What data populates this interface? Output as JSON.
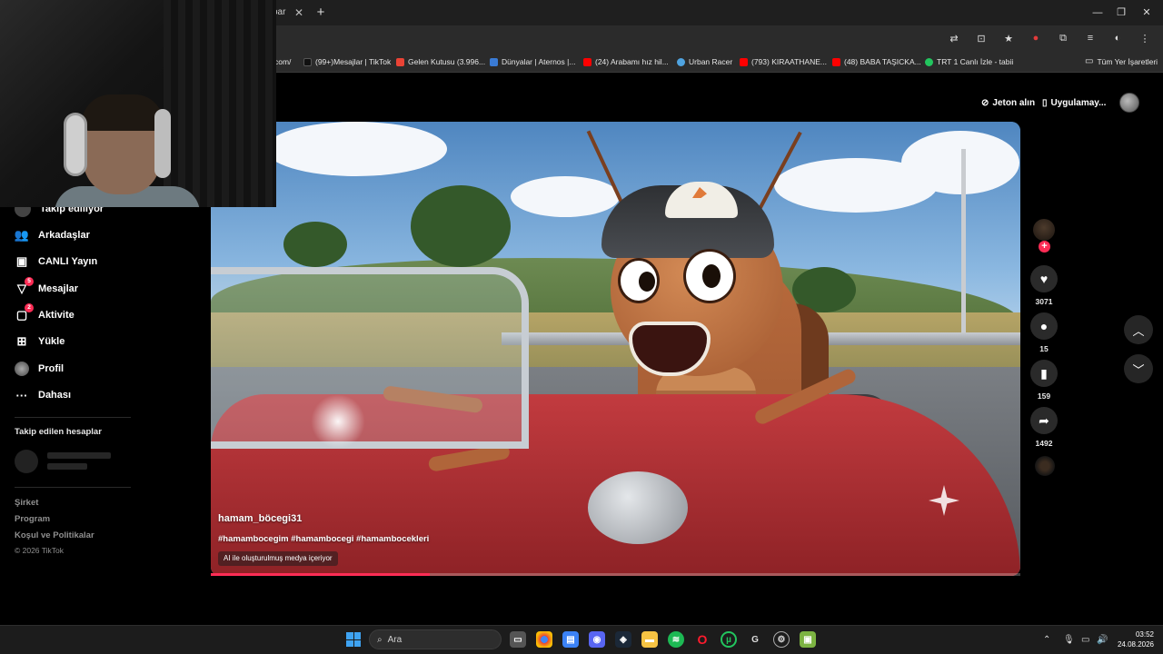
{
  "browser": {
    "tab_fragment": "oar",
    "bookmarks": [
      {
        "label": "com/",
        "color": ""
      },
      {
        "label": "(99+)Mesajlar | TikTok",
        "color": "#111111"
      },
      {
        "label": "Gelen Kutusu (3.996...",
        "color": "#ea4335"
      },
      {
        "label": "Dünyalar | Aternos |...",
        "color": "#3a7bd5"
      },
      {
        "label": "(24) Arabamı hız hil...",
        "color": "#ff0000"
      },
      {
        "label": "Urban Racer",
        "color": "#4fa3e0"
      },
      {
        "label": "(793) KIRAATHANE...",
        "color": "#ff0000"
      },
      {
        "label": "(48) BABA TAŞICKA...",
        "color": "#ff0000"
      },
      {
        "label": "TRT 1 Canlı İzle - tabii",
        "color": "#22c55e"
      }
    ],
    "all_bookmarks": "Tüm Yer İşaretleri"
  },
  "sidebar": {
    "items": [
      {
        "label": "Takip edilİyor",
        "icon": "following-icon",
        "badge": ""
      },
      {
        "label": "Arkadaşlar",
        "icon": "friends-icon",
        "badge": ""
      },
      {
        "label": "CANLI Yayın",
        "icon": "live-icon",
        "badge": ""
      },
      {
        "label": "Mesajlar",
        "icon": "messages-icon",
        "badge": "5"
      },
      {
        "label": "Aktivite",
        "icon": "activity-icon",
        "badge": "2"
      },
      {
        "label": "Yükle",
        "icon": "upload-icon",
        "badge": ""
      },
      {
        "label": "Profil",
        "icon": "profile-icon",
        "badge": ""
      },
      {
        "label": "Dahası",
        "icon": "more-icon",
        "badge": ""
      }
    ],
    "following_accounts_heading": "Takip edilen hesaplar",
    "footer": {
      "company": "Şirket",
      "program": "Program",
      "terms": "Koşul ve Politikalar",
      "copyright": "© 2026 TikTok"
    }
  },
  "header": {
    "coins_label": "Jeton alın",
    "app_label": "Uygulamay..."
  },
  "video": {
    "username": "hamam_böcegi31",
    "hashtags": "#hamambocegim #hamambocegi #hamambocekleri",
    "ai_label": "AI ile oluşturulmuş medya içeriyor",
    "progress": 0.27
  },
  "actions": {
    "likes": "3071",
    "comments": "15",
    "bookmarks": "159",
    "shares": "1492"
  },
  "taskbar": {
    "search_placeholder": "Ara",
    "time": "03:52",
    "date": "24.08.2026"
  },
  "colors": {
    "accent": "#fe2c55",
    "background": "#000000"
  }
}
